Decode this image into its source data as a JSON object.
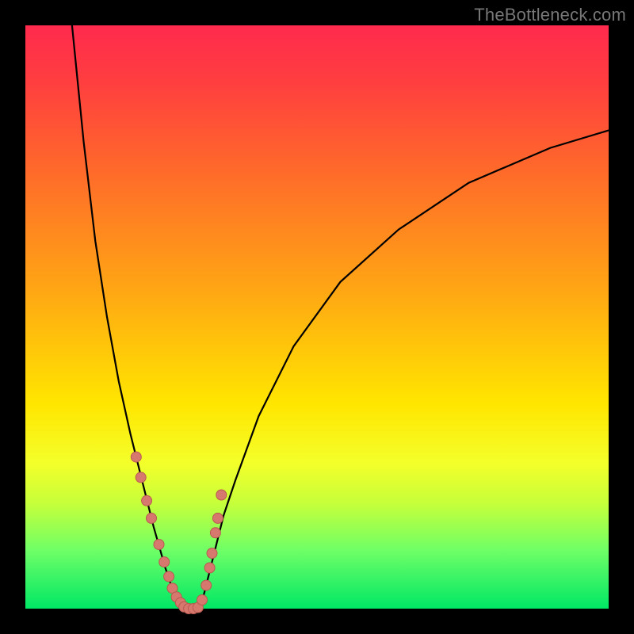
{
  "watermark": "TheBottleneck.com",
  "colors": {
    "background": "#000000",
    "gradient_top": "#ff2a4d",
    "gradient_bottom": "#00e765",
    "curve": "#000000",
    "marker_fill": "#d6786e",
    "marker_stroke": "#b95a50"
  },
  "chart_data": {
    "type": "line",
    "title": "",
    "xlabel": "",
    "ylabel": "",
    "xlim": [
      0,
      100
    ],
    "ylim": [
      0,
      100
    ],
    "grid": false,
    "curve_left": {
      "description": "steep descending arm",
      "x": [
        8,
        10,
        12,
        14,
        16,
        18,
        20,
        22,
        24,
        25,
        26,
        27
      ],
      "y": [
        100,
        80,
        63,
        50,
        39,
        30,
        22,
        14,
        7,
        4,
        2,
        0
      ]
    },
    "curve_flat": {
      "description": "minimum region",
      "x": [
        27,
        28,
        29,
        30
      ],
      "y": [
        0,
        0,
        0,
        0
      ]
    },
    "curve_right": {
      "description": "rising asymptotic arm",
      "x": [
        30,
        32,
        34,
        36,
        40,
        46,
        54,
        64,
        76,
        90,
        100
      ],
      "y": [
        0,
        8,
        16,
        22,
        33,
        45,
        56,
        65,
        73,
        79,
        82
      ]
    },
    "series": [
      {
        "name": "markers",
        "x": [
          19.0,
          19.8,
          20.8,
          21.6,
          22.9,
          23.8,
          24.6,
          25.2,
          25.9,
          26.6,
          27.2,
          28.0,
          28.8,
          29.6,
          30.3,
          31.0,
          31.6,
          32.0,
          32.6,
          33.0,
          33.6
        ],
        "y": [
          26.0,
          22.5,
          18.5,
          15.5,
          11.0,
          8.0,
          5.5,
          3.5,
          2.0,
          1.0,
          0.3,
          0.0,
          0.0,
          0.2,
          1.5,
          4.0,
          7.0,
          9.5,
          13.0,
          15.5,
          19.5
        ]
      }
    ],
    "minimum_x": 28.0
  }
}
